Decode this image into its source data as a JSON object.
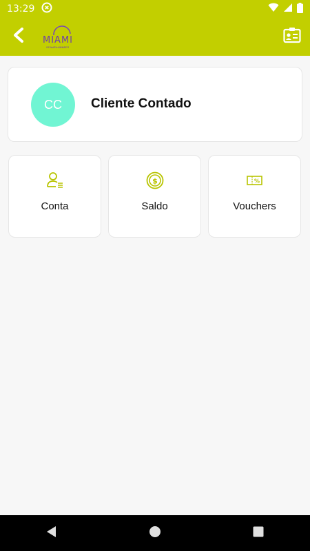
{
  "status_bar": {
    "time": "13:29",
    "icons": [
      "sync-icon",
      "wifi-icon",
      "signal-icon",
      "battery-icon"
    ]
  },
  "app_bar": {
    "logo": {
      "text": "MIAMI",
      "sub": "BEAUTY CENTER"
    },
    "back_icon": "chevron-left-icon",
    "action_icon": "contact-card-icon",
    "color": "#c2cf00"
  },
  "profile": {
    "initials": "CC",
    "name": "Cliente Contado",
    "avatar_color": "#71f5d3"
  },
  "tiles": [
    {
      "label": "Conta",
      "icon": "user-list-icon"
    },
    {
      "label": "Saldo",
      "icon": "coin-dollar-icon"
    },
    {
      "label": "Vouchers",
      "icon": "voucher-percent-icon"
    }
  ],
  "nav": [
    "back-triangle-icon",
    "home-circle-icon",
    "recents-square-icon"
  ]
}
